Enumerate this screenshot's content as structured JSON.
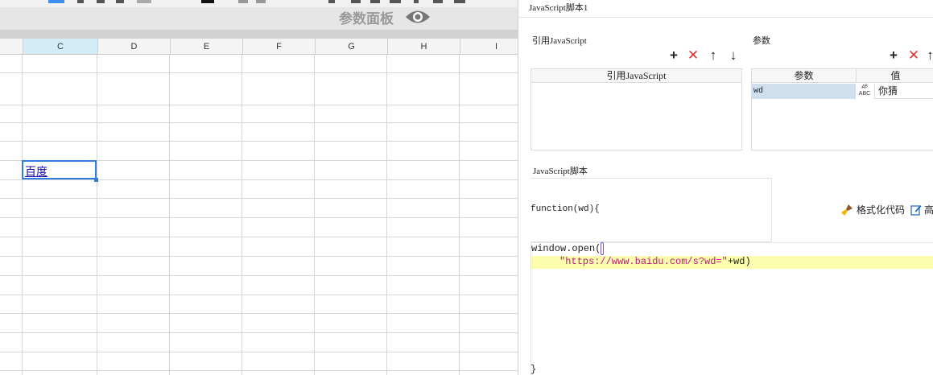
{
  "sheet": {
    "param_panel_label": "参数面板",
    "columns": [
      "C",
      "D",
      "E",
      "F",
      "G",
      "H",
      "I"
    ],
    "selected_column": "C",
    "cell_text": "百度"
  },
  "dialog": {
    "title": "JavaScript脚本1",
    "ref_section_label": "引用JavaScript",
    "ref_table_header": "引用JavaScript",
    "param_section_label": "参数",
    "param_table_headers": {
      "name": "参数",
      "value": "值"
    },
    "param_rows": [
      {
        "name": "wd",
        "type_icon": "ABC",
        "value": "你猜"
      }
    ],
    "script_section_label": "JavaScript脚本",
    "function_signature": "function(wd){",
    "format_code_label": "格式化代码",
    "highlight_label": "高",
    "code_lines": [
      "window.open(",
      "\"https://www.baidu.com/s?wd=\"",
      "+wd)",
      "}"
    ],
    "tool_icons": [
      "add-icon",
      "delete-icon",
      "move-up-icon",
      "move-down-icon"
    ],
    "colors": {
      "selection": "#2f7de1",
      "delete": "#e03030",
      "string": "#c0177d",
      "highlight_line": "#fdfdb0"
    }
  }
}
